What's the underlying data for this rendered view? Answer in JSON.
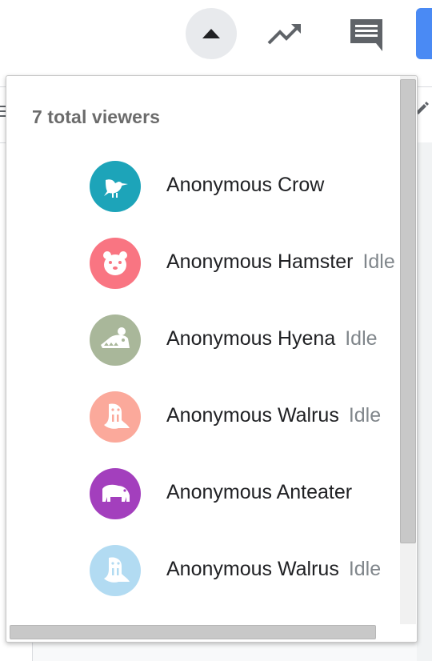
{
  "toolbar": {
    "collapse_icon": "caret-up-icon",
    "activity_icon": "trending-up-icon",
    "comments_icon": "comment-icon",
    "share_color": "#4a8af4"
  },
  "panel": {
    "title": "7 total viewers",
    "viewers": [
      {
        "name": "Anonymous Crow",
        "status": "",
        "animal": "crow",
        "color": "#1da4b9"
      },
      {
        "name": "Anonymous Hamster",
        "status": "Idle",
        "animal": "hamster",
        "color": "#f97582"
      },
      {
        "name": "Anonymous Hyena",
        "status": "Idle",
        "animal": "hyena",
        "color": "#a9b79a"
      },
      {
        "name": "Anonymous Walrus",
        "status": "Idle",
        "animal": "walrus",
        "color": "#fba99b"
      },
      {
        "name": "Anonymous Anteater",
        "status": "",
        "animal": "anteater",
        "color": "#a33fbd"
      },
      {
        "name": "Anonymous Walrus",
        "status": "Idle",
        "animal": "walrus",
        "color": "#b2dbf2"
      }
    ]
  }
}
